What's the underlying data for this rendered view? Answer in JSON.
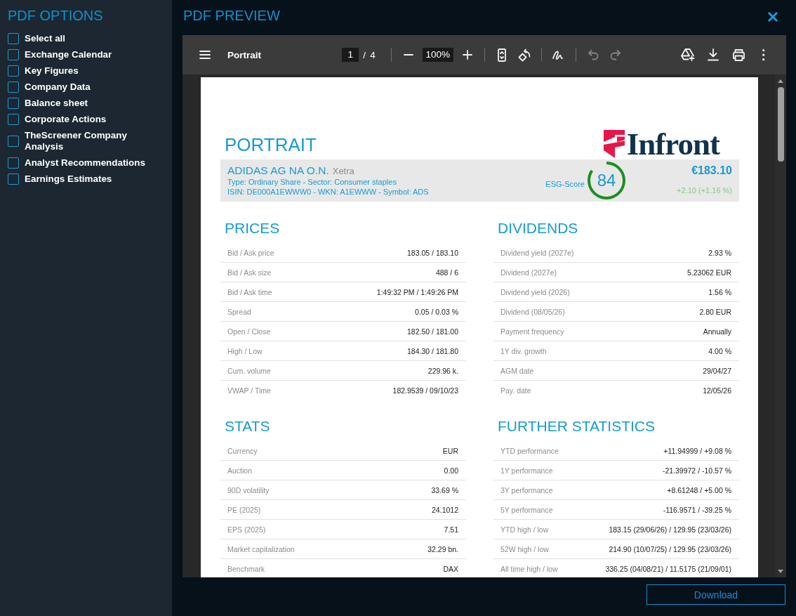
{
  "sidebar": {
    "title": "PDF OPTIONS",
    "options": [
      {
        "label": "Select all",
        "checked": false
      },
      {
        "label": "Exchange Calendar",
        "checked": false
      },
      {
        "label": "Key Figures",
        "checked": false
      },
      {
        "label": "Company Data",
        "checked": false
      },
      {
        "label": "Balance sheet",
        "checked": false
      },
      {
        "label": "Corporate Actions",
        "checked": false
      },
      {
        "label": "TheScreener Company Analysis",
        "checked": false
      },
      {
        "label": "Analyst Recommendations",
        "checked": false
      },
      {
        "label": "Earnings Estimates",
        "checked": false
      }
    ]
  },
  "preview": {
    "title": "PDF PREVIEW"
  },
  "toolbar": {
    "left": [
      {
        "kind": "menu",
        "disabled": false
      }
    ],
    "title": "Portrait",
    "center": [
      {
        "kind": "page-field",
        "value": "1"
      },
      {
        "kind": "text",
        "text": "/"
      },
      {
        "kind": "text",
        "text": "4"
      },
      {
        "kind": "divider"
      },
      {
        "kind": "zoom-out",
        "disabled": false
      },
      {
        "kind": "zoom-field",
        "value": "100%"
      },
      {
        "kind": "zoom-in",
        "disabled": false
      },
      {
        "kind": "divider"
      },
      {
        "kind": "fit-page",
        "disabled": false
      },
      {
        "kind": "rotate",
        "disabled": false
      },
      {
        "kind": "divider"
      },
      {
        "kind": "annotate",
        "disabled": false
      },
      {
        "kind": "divider"
      },
      {
        "kind": "undo",
        "disabled": true
      },
      {
        "kind": "redo",
        "disabled": true
      }
    ],
    "right": [
      {
        "kind": "drive",
        "disabled": false
      },
      {
        "kind": "download",
        "disabled": false
      },
      {
        "kind": "print",
        "disabled": false
      },
      {
        "kind": "more",
        "disabled": false
      }
    ]
  },
  "document": {
    "heading": "PORTRAIT",
    "logo": "Infront",
    "instrument": {
      "name": "ADIDAS AG NA O.N.",
      "exchange": "Xetra",
      "type_line": "Type: Ordinary Share - Sector: Consumer staples",
      "id_line": "ISIN: DE000A1EWWW0 - WKN: A1EWWW - Symbol: ADS",
      "esg": {
        "label": "ESG-Score",
        "score": "84"
      },
      "price": "€183.10",
      "change": "+2.10 (+1.16 %)"
    },
    "sections": [
      {
        "title": "PRICES",
        "rows": [
          {
            "label": "Bid / Ask price",
            "value": "183.05 / 183.10"
          },
          {
            "label": "Bid / Ask size",
            "value": "488 / 6"
          },
          {
            "label": "Bid / Ask time",
            "value": "1:49:32 PM / 1:49:26 PM"
          },
          {
            "label": "Spread",
            "value": "0.05 / 0.03 %"
          },
          {
            "label": "Open / Close",
            "value": "182.50 / 181.00"
          },
          {
            "label": "High / Low",
            "value": "184.30 / 181.80"
          },
          {
            "label": "Cum. volume",
            "value": "229.96 k."
          },
          {
            "label": "VWAP / Time",
            "value": "182.9539 / 09/10/23"
          }
        ]
      },
      {
        "title": "DIVIDENDS",
        "rows": [
          {
            "label": "Dividend yield (2027e)",
            "value": "2.93 %"
          },
          {
            "label": "Dividend (2027e)",
            "value": "5.23062 EUR"
          },
          {
            "label": "Dividend yield (2026)",
            "value": "1.56 %"
          },
          {
            "label": "Dividend (08/05/26)",
            "value": "2.80 EUR"
          },
          {
            "label": "Payment frequency",
            "value": "Annually"
          },
          {
            "label": "1Y div. growth",
            "value": "4.00 %"
          },
          {
            "label": "AGM date",
            "value": "29/04/27"
          },
          {
            "label": "Pay. date",
            "value": "12/05/26"
          }
        ]
      },
      {
        "title": "STATS",
        "rows": [
          {
            "label": "Currency",
            "value": "EUR"
          },
          {
            "label": "Auction",
            "value": "0.00"
          },
          {
            "label": "90D volatility",
            "value": "33.69 %"
          },
          {
            "label": "PE (2025)",
            "value": "24.1012"
          },
          {
            "label": "EPS (2025)",
            "value": "7.51"
          },
          {
            "label": "Market capitalization",
            "value": "32.29 bn."
          },
          {
            "label": "Benchmark",
            "value": "DAX"
          }
        ]
      },
      {
        "title": "FURTHER STATISTICS",
        "rows": [
          {
            "label": "YTD performance",
            "value": "+11.94999 / +9.08 %"
          },
          {
            "label": "1Y performance",
            "value": "-21.39972 / -10.57 %"
          },
          {
            "label": "3Y performance",
            "value": "+8.61248 / +5.00 %"
          },
          {
            "label": "5Y performance",
            "value": "-116.9571 / -39.25 %"
          },
          {
            "label": "YTD high / low",
            "value": "183.15 (29/06/26) / 129.95 (23/03/26)"
          },
          {
            "label": "52W high / low",
            "value": "214.90 (10/07/25) / 129.95 (23/03/26)"
          },
          {
            "label": "All time high / low",
            "value": "336.25 (04/08/21) / 11.5175 (21/09/01)"
          }
        ]
      }
    ]
  },
  "footer": {
    "button": "Download"
  }
}
